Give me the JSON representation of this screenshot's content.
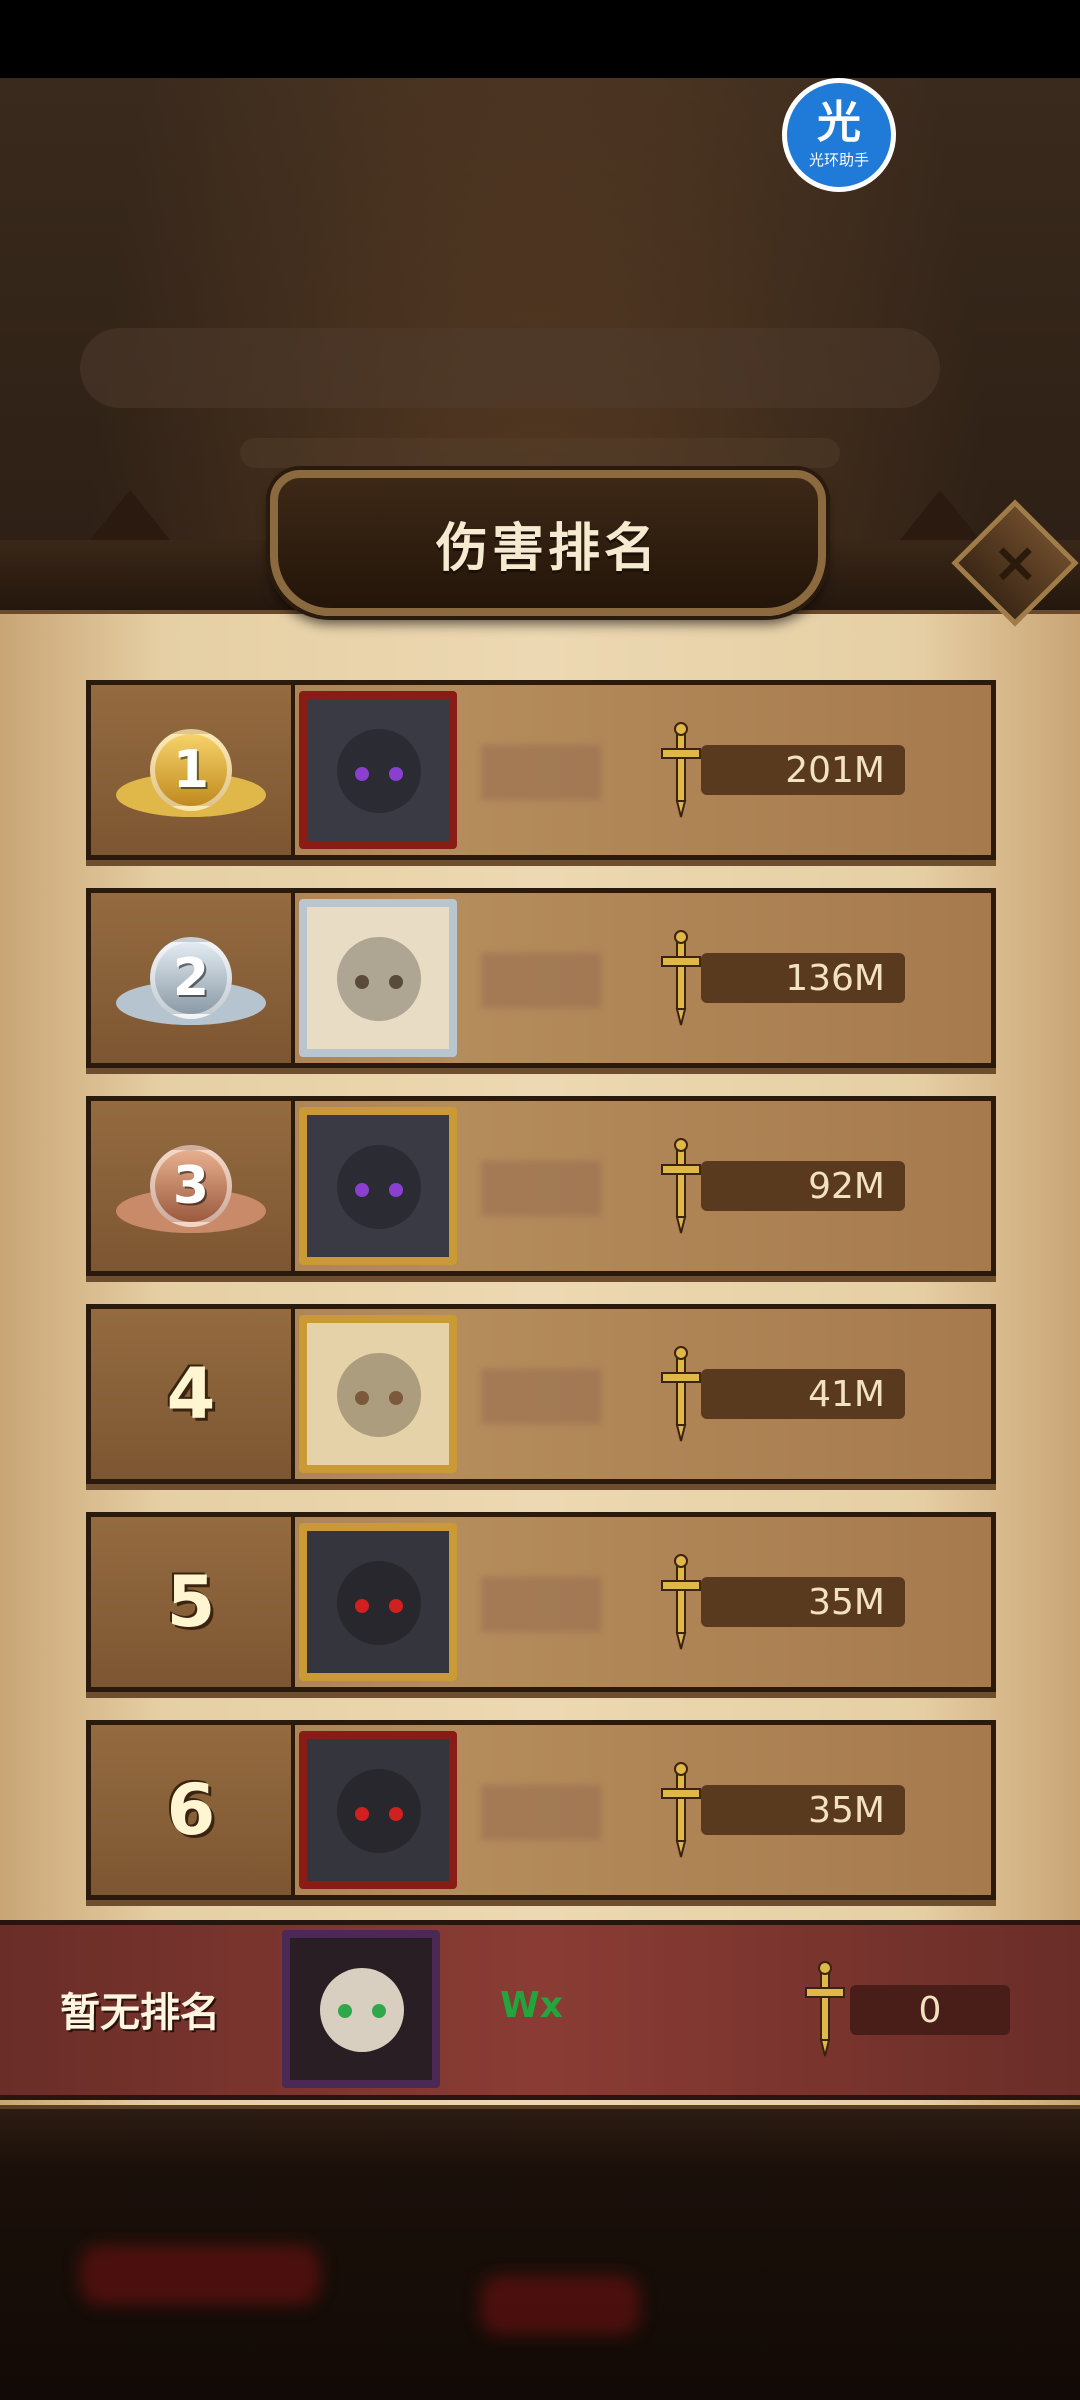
{
  "title": "伤害排名",
  "overlay_badge": {
    "big": "光",
    "small": "光环助手"
  },
  "rows": [
    {
      "rank": "1",
      "medal": "gold",
      "score": "201M",
      "frame": "red",
      "avatar_colors": [
        "#3a3a45",
        "#8b3fd1"
      ]
    },
    {
      "rank": "2",
      "medal": "silver",
      "score": "136M",
      "frame": "silver",
      "avatar_colors": [
        "#e8dcc4",
        "#5a4a3a"
      ]
    },
    {
      "rank": "3",
      "medal": "bronze",
      "score": "92M",
      "frame": "gold",
      "avatar_colors": [
        "#3a3a45",
        "#8b3fd1"
      ]
    },
    {
      "rank": "4",
      "medal": "none",
      "score": "41M",
      "frame": "gold",
      "avatar_colors": [
        "#e6d2a8",
        "#7a5a3a"
      ]
    },
    {
      "rank": "5",
      "medal": "none",
      "score": "35M",
      "frame": "gold",
      "avatar_colors": [
        "#35353d",
        "#d02020"
      ]
    },
    {
      "rank": "6",
      "medal": "none",
      "score": "35M",
      "frame": "red",
      "avatar_colors": [
        "#35353d",
        "#d02020"
      ]
    }
  ],
  "my_rank": {
    "label": "暂无排名",
    "name": "Wx",
    "score": "0"
  },
  "colors": {
    "gold": "#e0b84a",
    "silver": "#b6c4cf",
    "bronze": "#c98a6a",
    "accent_green": "#21a53c"
  },
  "icons": {
    "score": "sword-icon",
    "close": "close-icon"
  }
}
